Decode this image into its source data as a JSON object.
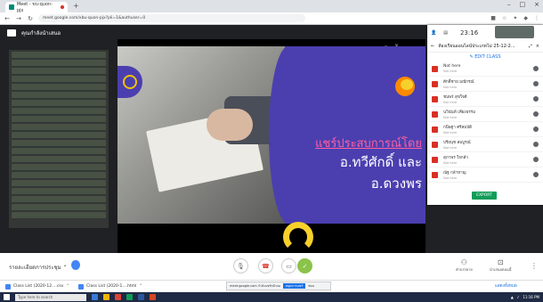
{
  "browser": {
    "tab_title": "Meet - ขบ-quon-pjx",
    "new_tab": "+",
    "url": "meet.google.com/xbu-quon-pjx?pli=1&authuser=0",
    "window_controls": [
      "–",
      "□",
      "×"
    ]
  },
  "meet": {
    "title": "คุณกำลังนำเสนอ",
    "meeting_code_label": "รายละเอียดการประชุม",
    "controls": {
      "mic": "mic",
      "hangup": "call-end",
      "camera": "video",
      "present": "present-to-all"
    },
    "captions_label": "คำบรรยาย",
    "present_now_label": "นำเสนอตอนนี้"
  },
  "slide": {
    "line1": "แชร์ประสบการณ์โดย",
    "line2": "อ.ทวีศักดิ์ และ",
    "line3": "อ.ดวงพร",
    "accent_color": "#4b3fb0",
    "highlight_color": "#ff5fa2"
  },
  "side_panel": {
    "clock": "23:16",
    "class_title": "ห้องเรียนออนไลน์ประเภทไม่ 25-12-2...",
    "edit_class": "EDIT CLASS",
    "students": [
      {
        "name": "Not here",
        "sub": "Not here"
      },
      {
        "name": "ศักดิ์ชาย มณีกรณ์",
        "sub": "Not here"
      },
      {
        "name": "ชนพร สุขใจดี",
        "sub": "Not here"
      },
      {
        "name": "นวินันท์ เที่ยงธรรม",
        "sub": "Not here"
      },
      {
        "name": "กนิษฐา ศรีสมบัติ",
        "sub": "Not here"
      },
      {
        "name": "ปรียนุช สมบูรณ์",
        "sub": "Not here"
      },
      {
        "name": "สุภาพร ใจกล้า",
        "sub": "Not here"
      },
      {
        "name": "ณัฐ กล้าหาญ",
        "sub": "Not here"
      }
    ],
    "export_label": "EXPORT"
  },
  "downloads": {
    "items": [
      "Class List (2020-12....csv",
      "Class List (2020-1....html"
    ],
    "share_text": "meet.google.com กำลังแชร์หน้าจอ",
    "share_stop": "หยุดการแชร์",
    "share_hide": "ซ่อน",
    "show_all": "แสดงทั้งหมด"
  },
  "taskbar": {
    "search_placeholder": "Type here to search",
    "time": "11:16 PM"
  }
}
